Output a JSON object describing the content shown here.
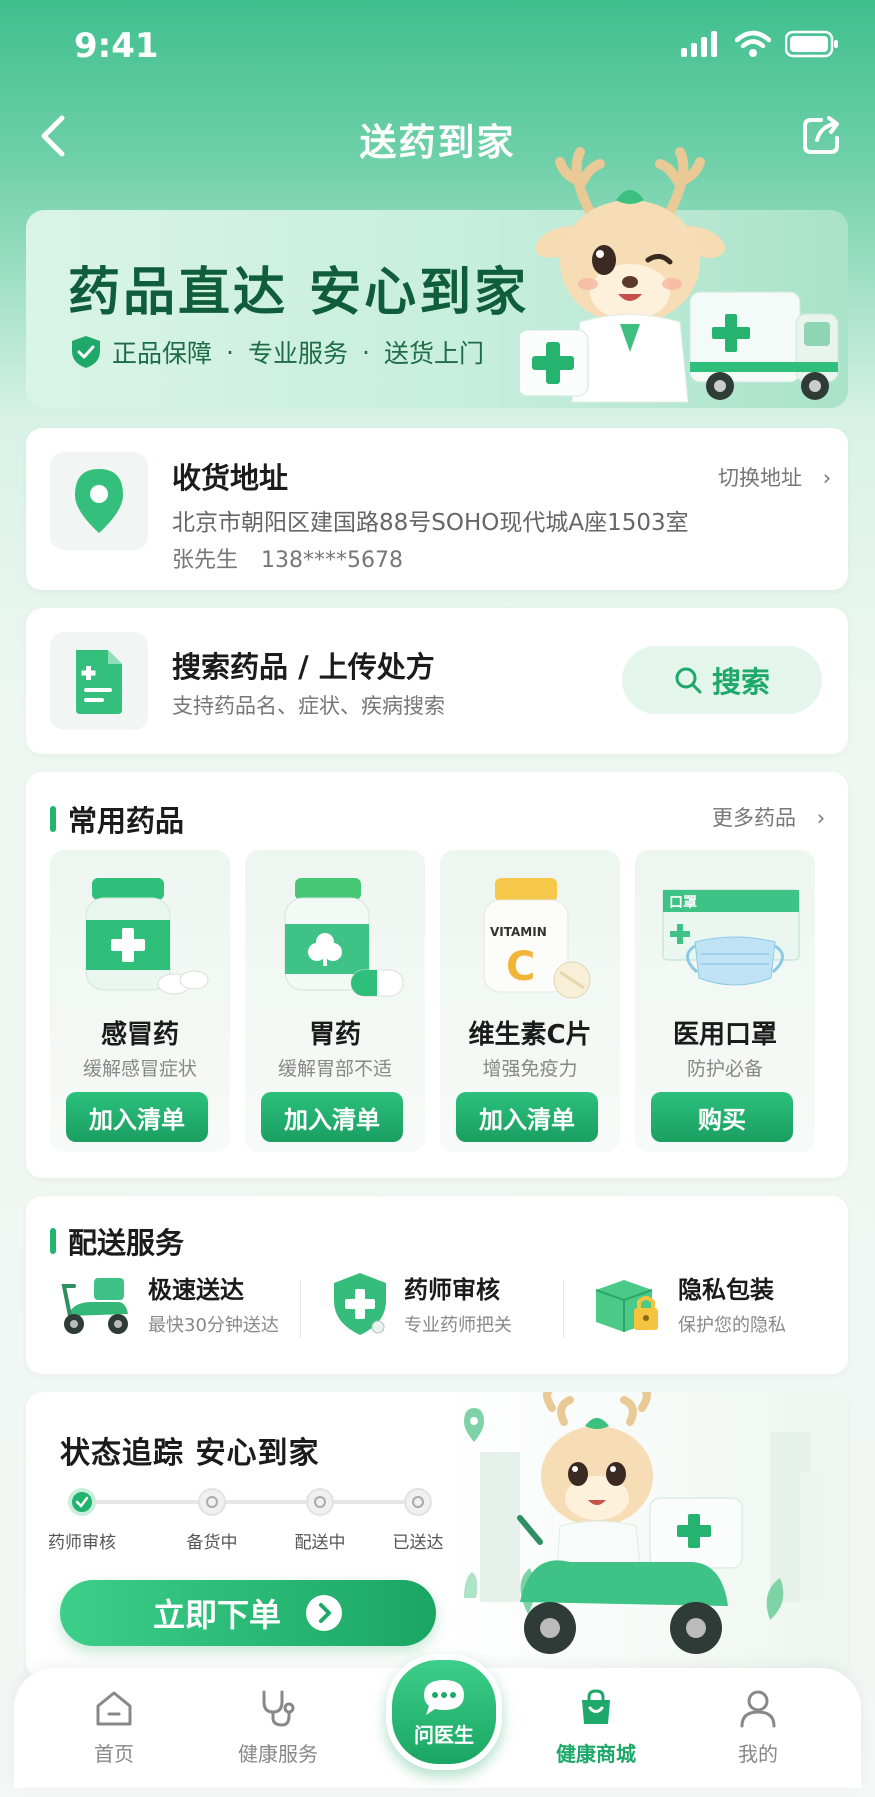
{
  "status_bar": {
    "time": "9:41"
  },
  "nav": {
    "title": "送药到家",
    "back_icon": "chevron-left-icon",
    "share_icon": "share-icon"
  },
  "banner": {
    "title": "药品直达  安心到家",
    "subtitle_items": [
      "正品保障",
      "专业服务",
      "送货上门"
    ],
    "separator": "·"
  },
  "address": {
    "title": "收货地址",
    "switch_label": "切换地址",
    "line": "北京市朝阳区建国路88号SOHO现代城A座1503室",
    "name": "张先生",
    "phone": "138****5678"
  },
  "search": {
    "title": "搜索药品 / 上传处方",
    "subtitle": "支持药品名、症状、疾病搜索",
    "button_label": "搜索"
  },
  "common_drugs": {
    "title": "常用药品",
    "more_label": "更多药品",
    "items": [
      {
        "name": "感冒药",
        "desc": "缓解感冒症状",
        "button": "加入清单"
      },
      {
        "name": "胃药",
        "desc": "缓解胃部不适",
        "button": "加入清单"
      },
      {
        "name": "维生素C片",
        "desc": "增强免疫力",
        "button": "加入清单",
        "label_text": "VITAMIN",
        "label_letter": "C"
      },
      {
        "name": "医用口罩",
        "desc": "防护必备",
        "button": "购买",
        "box_text": "口罩"
      }
    ]
  },
  "delivery_service": {
    "title": "配送服务",
    "items": [
      {
        "title": "极速送达",
        "sub": "最快30分钟送达",
        "icon": "scooter-icon"
      },
      {
        "title": "药师审核",
        "sub": "专业药师把关",
        "icon": "shield-plus-icon"
      },
      {
        "title": "隐私包装",
        "sub": "保护您的隐私",
        "icon": "package-lock-icon"
      }
    ]
  },
  "tracking": {
    "title": "状态追踪  安心到家",
    "steps": [
      "药师审核",
      "备货中",
      "配送中",
      "已送达"
    ],
    "active_step": 0,
    "order_button": "立即下单"
  },
  "tabbar": {
    "items": [
      {
        "label": "首页",
        "icon": "home-icon"
      },
      {
        "label": "健康服务",
        "icon": "stethoscope-icon"
      },
      {
        "label": "问医生",
        "icon": "chat-icon"
      },
      {
        "label": "健康商城",
        "icon": "shopping-bag-icon"
      },
      {
        "label": "我的",
        "icon": "user-icon"
      }
    ],
    "active": "健康商城"
  },
  "colors": {
    "primary": "#1ea86a",
    "primary_light": "#3ccf8a",
    "dark_green": "#0f5d3c"
  }
}
